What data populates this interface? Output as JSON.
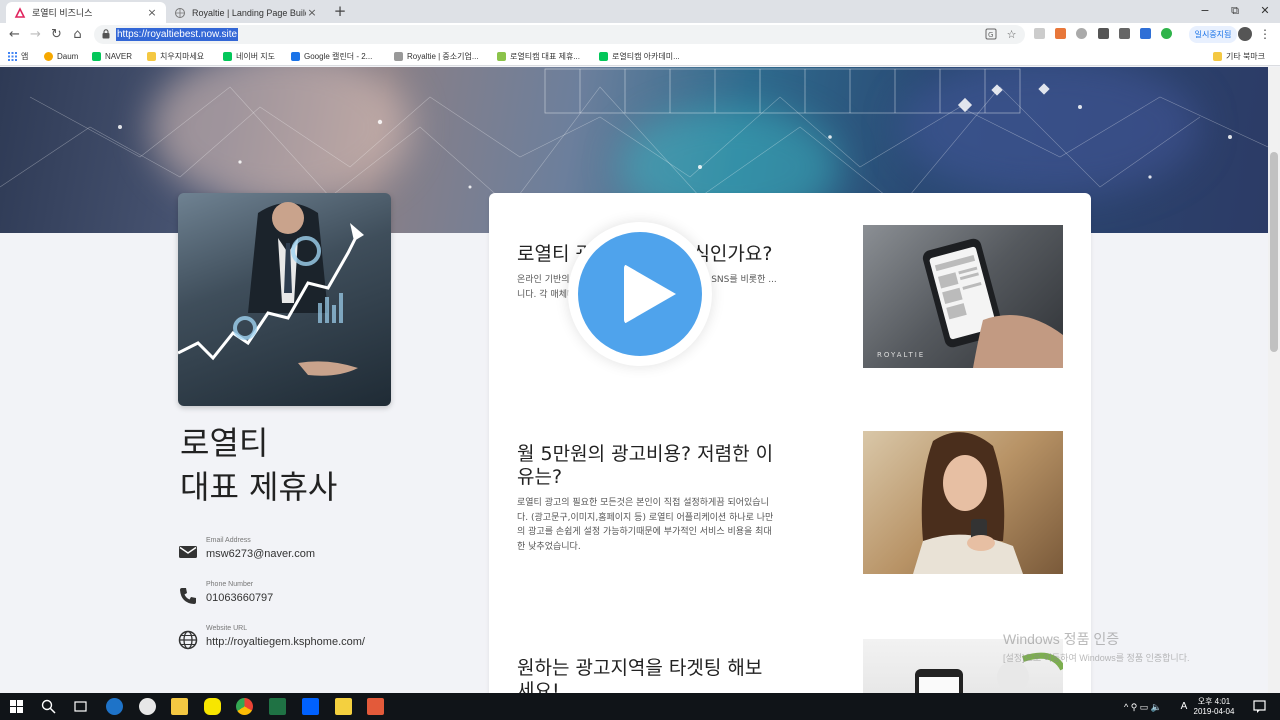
{
  "tabs": [
    {
      "title": "로열티 비즈니스",
      "close": "×"
    },
    {
      "title": "Royaltie | Landing Page Builder",
      "close": "×"
    }
  ],
  "new_tab": "+",
  "window_controls": {
    "minimize": "−",
    "restore": "⧉",
    "close": "✕"
  },
  "toolbar": {
    "back": "←",
    "forward": "→",
    "reload": "↻",
    "home": "⌂",
    "url": "https://royaltiebest.now.site",
    "pause_label": "일시중지됨",
    "menu": "⋮"
  },
  "bookmarks": [
    {
      "label": "앱",
      "color": "#4285f4"
    },
    {
      "label": "Daum",
      "color": "#f6a800"
    },
    {
      "label": "NAVER",
      "color": "#03c75a"
    },
    {
      "label": "치우지마세요",
      "color": "#f4c842"
    },
    {
      "label": "네이버 지도",
      "color": "#03c75a"
    },
    {
      "label": "Google 캘린더 - 2...",
      "color": "#1a73e8"
    },
    {
      "label": "Royaltie | 중소기업...",
      "color": "#999999"
    },
    {
      "label": "로열티캠 대표 제휴...",
      "color": "#8bc34a"
    },
    {
      "label": "로열티캠 아카데미...",
      "color": "#03c75a"
    }
  ],
  "other_bookmarks": "기타 북마크",
  "profile": {
    "title_line1": "로열티",
    "title_line2": "대표 제휴사"
  },
  "contacts": [
    {
      "label": "Email Address",
      "value": "msw6273@naver.com",
      "icon": "mail-icon"
    },
    {
      "label": "Phone Number",
      "value": "01063660797",
      "icon": "phone-icon"
    },
    {
      "label": "Website URL",
      "value": "http://royaltiegem.ksphome.com/",
      "icon": "globe-icon"
    }
  ],
  "features": [
    {
      "title": "로열티 광고는 어떤 방식인가요?",
      "body": "온라인 기반의 광고로 ... 인기 사이트,어플리케이션,SNS를 비롯한 ... 니다. 각 매체마다 위치하는 배너 ..."
    },
    {
      "title": "월 5만원의 광고비용? 저렴한 이유는?",
      "body": "로열티 광고의 필요한 모든것은 본인이 직접 설정하게끔 되어있습니다. (광고문구,이미지,홈페이지 등) 로열티 어플리케이션 하나로 나만의 광고를 손쉽게 설정 가능하기때문에 부가적인 서비스 비용을 최대한 낮추었습니다."
    },
    {
      "title": "원하는 광고지역을 타겟팅 해보세요!",
      "body": ""
    }
  ],
  "feature_image_brand": "ROYALTIE",
  "watermark": {
    "title": "Windows 정품 인증",
    "sub": "[설정]으로 이동하여 Windows를 정품 인증합니다."
  },
  "taskbar": {
    "time": "오후 4:01",
    "date": "2019-04-04",
    "ime": "A"
  },
  "colors": {
    "play_button": "#4fa3ec",
    "url_highlight": "#3367d6",
    "page_bg": "#f2f3f7"
  }
}
